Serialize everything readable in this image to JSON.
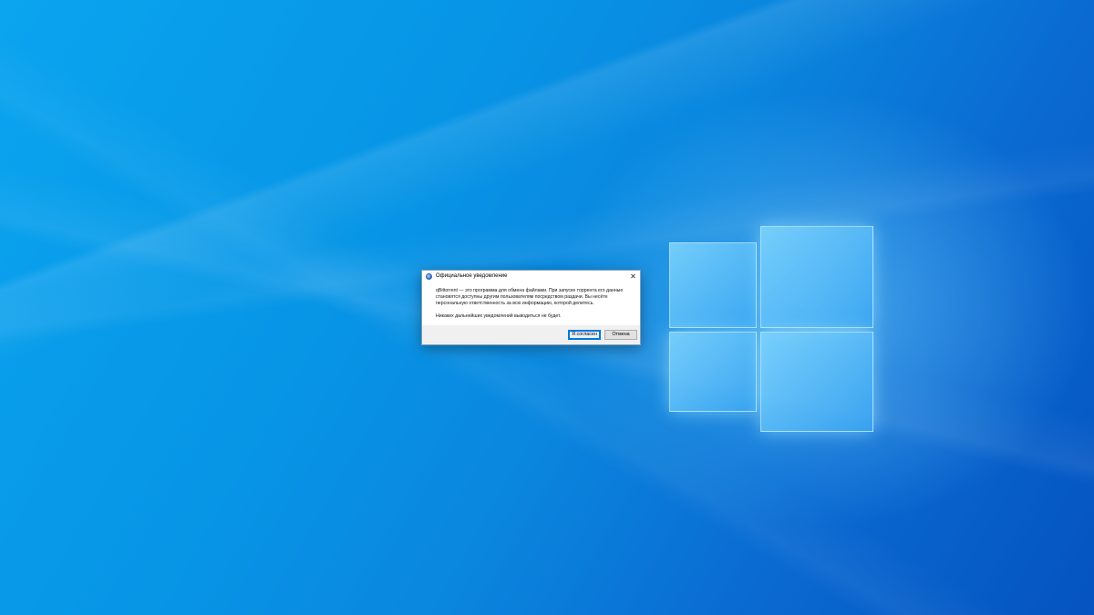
{
  "dialog": {
    "title": "Официальное уведомление",
    "close_symbol": "✕",
    "message_1": "qBittorrent — это программа для обмена файлами. При запуске торрента его данные становятся доступны другим пользователям посредством раздачи. Вы несёте персональную ответственность за всю информацию, которой делитесь.",
    "message_2": "Никаких дальнейших уведомлений выводиться не будет.",
    "buttons": {
      "agree": "Я согласен",
      "cancel": "Отмена"
    },
    "icon": "qbittorrent-app-icon"
  },
  "desktop": {
    "wallpaper": "windows-10-hero",
    "logo": "windows-logo",
    "colors": {
      "background": "#0a86de",
      "accent": "#0078d7"
    }
  }
}
